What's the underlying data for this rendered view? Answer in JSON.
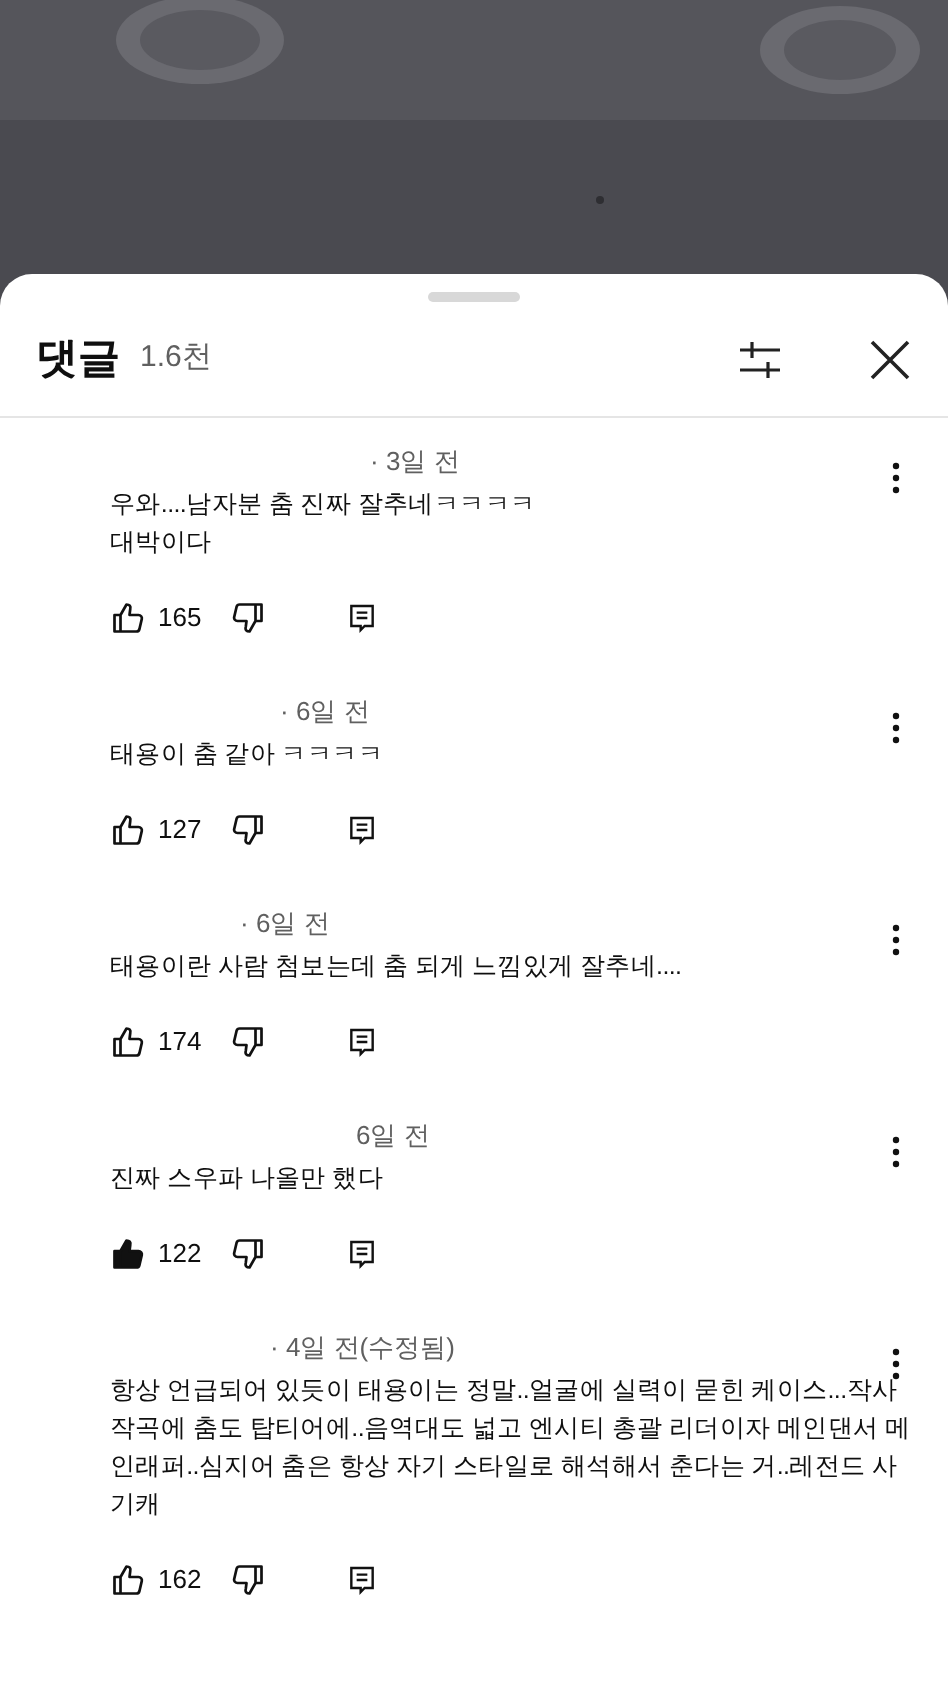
{
  "header": {
    "title": "댓글",
    "count": "1.6천"
  },
  "comments": [
    {
      "meta": "· 3일 전",
      "lines": [
        "우와....남자분 춤 진짜 잘추네ㅋㅋㅋㅋ",
        "대박이다"
      ],
      "likes": "165",
      "liked": false
    },
    {
      "meta": "· 6일 전",
      "lines": [
        "태용이 춤 같아 ㅋㅋㅋㅋ"
      ],
      "likes": "127",
      "liked": false
    },
    {
      "meta": "· 6일 전",
      "lines": [
        "태용이란 사람 첨보는데 춤 되게 느낌있게 잘추네...."
      ],
      "likes": "174",
      "liked": false
    },
    {
      "meta": "6일 전",
      "lines": [
        "진짜 스우파 나올만 했다"
      ],
      "likes": "122",
      "liked": true
    },
    {
      "meta": "· 4일 전(수정됨)",
      "lines": [
        "항상 언급되어 있듯이 태용이는 정말..얼굴에 실력이 묻힌 케이스...작사",
        "작곡에 춤도 탑티어에..음역대도 넓고 엔시티 총괄 리더이자 메인댄서 메",
        "인래퍼..심지어 춤은 항상 자기 스타일로 해석해서 춘다는 거..레전드 사",
        "기캐"
      ],
      "likes": "162",
      "liked": false
    }
  ]
}
